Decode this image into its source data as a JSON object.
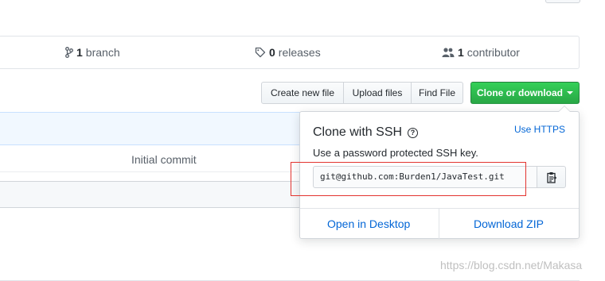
{
  "repo_summary": {
    "branches": {
      "count": "1",
      "label": "branch",
      "icon": "git-branch-icon"
    },
    "releases": {
      "count": "0",
      "label": "releases",
      "icon": "tag-icon"
    },
    "contributors": {
      "count": "1",
      "label": "contributor",
      "icon": "people-icon"
    }
  },
  "toolbar": {
    "create_new_file": "Create new file",
    "upload_files": "Upload files",
    "find_file": "Find File",
    "clone_or_download": "Clone or download"
  },
  "file_list": {
    "commit_message": "Initial commit"
  },
  "clone_dropdown": {
    "title": "Clone with SSH",
    "help_icon": "question-icon",
    "use_https": "Use HTTPS",
    "description": "Use a password protected SSH key.",
    "url": "git@github.com:Burden1/JavaTest.git",
    "copy_icon": "clipboard-icon",
    "open_in_desktop": "Open in Desktop",
    "download_zip": "Download ZIP"
  },
  "watermark": "https://blog.csdn.net/Makasa",
  "colors": {
    "clone_button": "#28a745",
    "link": "#0366d6",
    "highlight_box": "#e3342f"
  }
}
